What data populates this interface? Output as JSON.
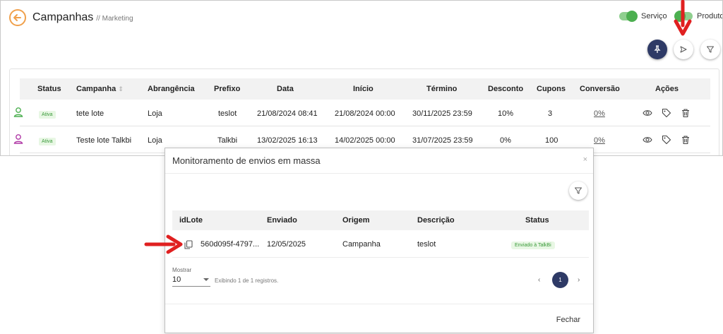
{
  "header": {
    "title": "Campanhas",
    "breadcrumb": "// Marketing",
    "toggles": [
      {
        "label": "Serviço",
        "on": true
      },
      {
        "label": "Produto",
        "on": false
      }
    ]
  },
  "icons": {
    "back": "arrow-left-circle-icon",
    "pin": "pin-icon",
    "send": "send-icon",
    "filter": "filter-icon",
    "eye": "eye-icon",
    "tag": "tag-icon",
    "trash": "trash-icon",
    "copy": "copy-icon"
  },
  "colors": {
    "accent_orange": "#f0a04b",
    "navy": "#2e3a66",
    "toggle_green": "#4caf50",
    "status_green_bg": "#e8f7e4",
    "status_green_text": "#3a9a3a",
    "annotation_red": "#e02020",
    "user_green": "#4caf50",
    "user_purple": "#b03aa6"
  },
  "campaigns": {
    "columns": [
      "Status",
      "Campanha",
      "Abrangência",
      "Prefixo",
      "Data",
      "Início",
      "Término",
      "Desconto",
      "Cupons",
      "Conversão",
      "Ações"
    ],
    "sort_indicator": "⇕",
    "rows": [
      {
        "status": "Ativa",
        "campanha": "tete lote",
        "abrangencia": "Loja",
        "prefixo": "teslot",
        "data": "21/08/2024 08:41",
        "inicio": "21/08/2024 00:00",
        "termino": "30/11/2025 23:59",
        "desconto": "10%",
        "cupons": "3",
        "conversao": "0%"
      },
      {
        "status": "Ativa",
        "campanha": "Teste lote Talkbi",
        "abrangencia": "Loja",
        "prefixo": "Talkbi",
        "data": "13/02/2025 16:13",
        "inicio": "14/02/2025 00:00",
        "termino": "31/07/2025 23:59",
        "desconto": "0%",
        "cupons": "100",
        "conversao": "0%"
      }
    ]
  },
  "dialog": {
    "title": "Monitoramento de envios em massa",
    "close_glyph": "×",
    "columns": [
      "idLote",
      "Enviado",
      "Origem",
      "Descrição",
      "Status"
    ],
    "rows": [
      {
        "idLote": "560d095f-4797...",
        "enviado": "12/05/2025",
        "origem": "Campanha",
        "descricao": "teslot",
        "status": "Enviado à TalkBi"
      }
    ],
    "show_label": "Mostrar",
    "page_size": "10",
    "records_info": "Exibindo 1 de 1 registros.",
    "pager": {
      "prev": "‹",
      "current": "1",
      "next": "›"
    },
    "close_label": "Fechar"
  }
}
